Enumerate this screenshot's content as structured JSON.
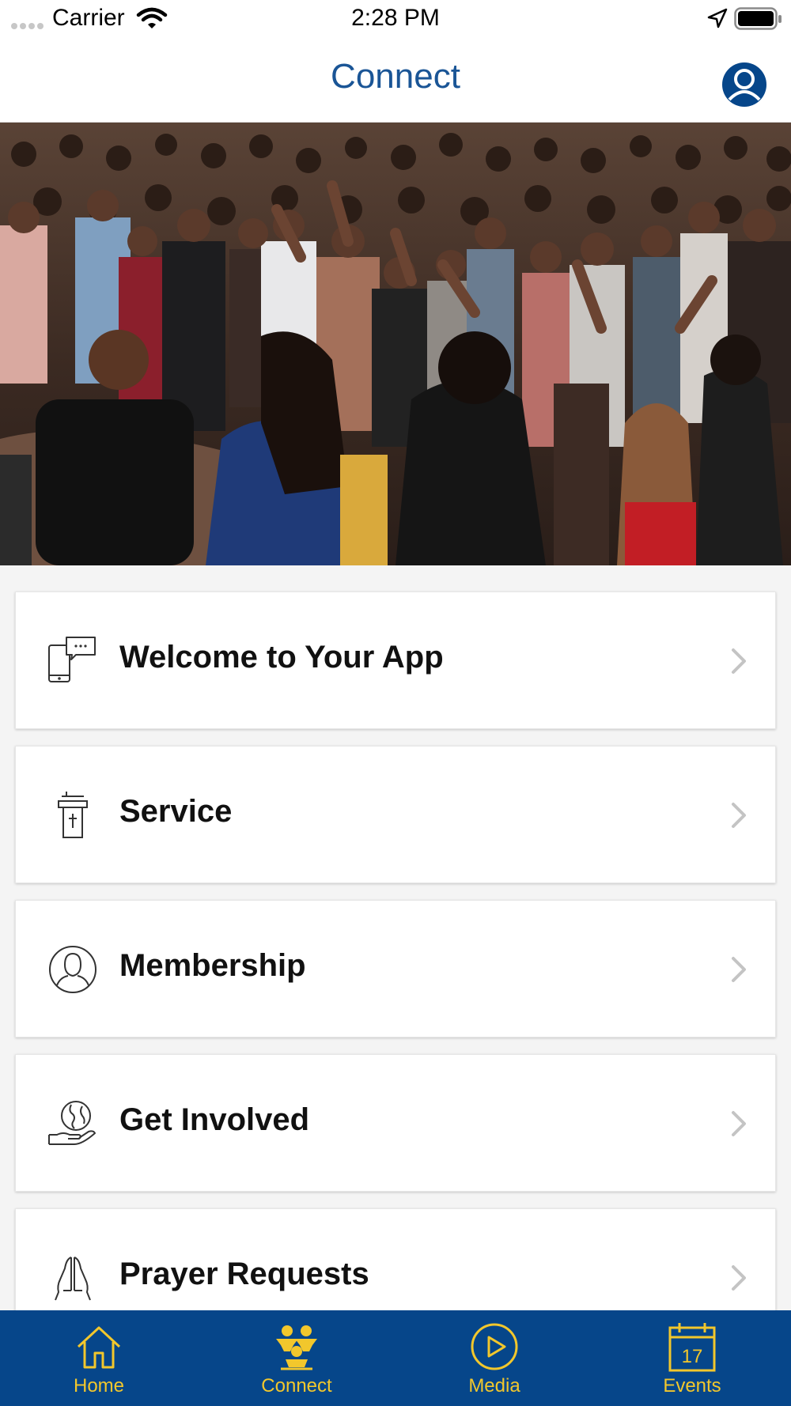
{
  "status_bar": {
    "carrier": "Carrier",
    "time": "2:28 PM"
  },
  "nav": {
    "title": "Connect",
    "profile_icon": "user-circle-icon"
  },
  "hero": {
    "icon": "worship-crowd-photo"
  },
  "menu": [
    {
      "label": "Welcome to Your App",
      "icon": "phone-chat-icon"
    },
    {
      "label": "Service",
      "icon": "pulpit-icon"
    },
    {
      "label": "Membership",
      "icon": "person-circle-icon"
    },
    {
      "label": "Get Involved",
      "icon": "globe-hand-icon"
    },
    {
      "label": "Prayer Requests",
      "icon": "praying-hands-icon"
    }
  ],
  "tabs": [
    {
      "label": "Home",
      "icon": "house-icon"
    },
    {
      "label": "Connect",
      "icon": "group-icon",
      "active": true
    },
    {
      "label": "Media",
      "icon": "play-circle-icon"
    },
    {
      "label": "Events",
      "icon": "calendar-icon",
      "date": "17"
    }
  ],
  "colors": {
    "accent": "#1a5596",
    "tab_bar": "#06468a",
    "tab_label": "#f2c72c"
  }
}
